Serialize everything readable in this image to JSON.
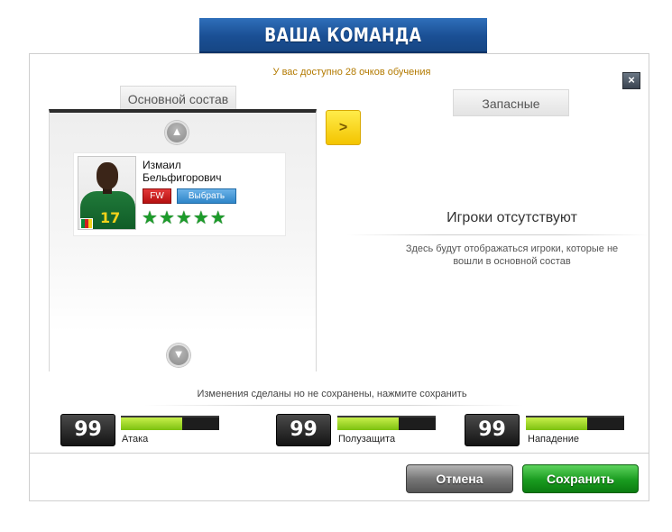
{
  "header": {
    "title": "ВАША КОМАНДА"
  },
  "training_note": "У вас доступно 28 очков обучения",
  "close_icon": "×",
  "tabs": {
    "main_lineup": "Основной состав",
    "substitutes": "Запасные"
  },
  "lineup": {
    "scroll_up_icon": "chevron-up-icon",
    "scroll_down_icon": "chevron-down-icon",
    "players": [
      {
        "name": "Измаил Бельфигорович",
        "position": "FW",
        "select_label": "Выбрать",
        "shirt_number": "17",
        "stars": 5,
        "flag_colors": [
          "#0a8a3a",
          "#d21f1f",
          "#f2d21b"
        ]
      }
    ]
  },
  "move_button_label": ">",
  "bench": {
    "empty_title": "Игроки отсутствуют",
    "empty_description": "Здесь будут отображаться игроки, которые не вошли в основной состав"
  },
  "unsaved_message": "Изменения сделаны но не сохранены, нажмите сохранить",
  "stats": [
    {
      "value": "99",
      "label": "Атака",
      "level": 0.62
    },
    {
      "value": "99",
      "label": "Полузащита",
      "level": 0.62
    },
    {
      "value": "99",
      "label": "Нападение",
      "level": 0.62
    }
  ],
  "buttons": {
    "cancel": "Отмена",
    "save": "Сохранить"
  },
  "colors": {
    "accent_blue": "#1a4f94",
    "save_green": "#199b1f",
    "training_note": "#b37a00",
    "move_yellow": "#f3c400"
  }
}
